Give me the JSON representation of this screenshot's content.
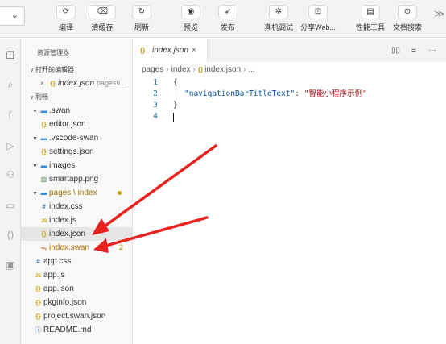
{
  "toolbar": {
    "project_dropdown_chevron": "⌄",
    "buttons": [
      {
        "name": "compile",
        "icon": "restart-icon",
        "glyph": "⟳",
        "label": "编译"
      },
      {
        "name": "clear-cache",
        "icon": "clear-cache-icon",
        "glyph": "⌫",
        "label": "清缓存"
      },
      {
        "name": "refresh",
        "icon": "refresh-icon",
        "glyph": "↻",
        "label": "刷新"
      },
      {
        "name": "preview",
        "icon": "eye-icon",
        "glyph": "◉",
        "label": "预览"
      },
      {
        "name": "publish",
        "icon": "send-icon",
        "glyph": "➶",
        "label": "发布"
      },
      {
        "name": "device-debug",
        "icon": "bug-icon",
        "glyph": "✲",
        "label": "真机调试"
      },
      {
        "name": "share-web",
        "icon": "share-icon",
        "glyph": "⊡",
        "label": "分享Web..."
      },
      {
        "name": "performance",
        "icon": "performance-icon",
        "glyph": "▤",
        "label": "性能工具"
      },
      {
        "name": "doc-search",
        "icon": "doc-search-icon",
        "glyph": "⊙",
        "label": "文档搜索"
      }
    ],
    "more": "≫"
  },
  "activity_bar": [
    {
      "name": "explorer",
      "icon": "files-icon",
      "glyph": "❐",
      "active": true
    },
    {
      "name": "search",
      "icon": "search-icon",
      "glyph": "⌕"
    },
    {
      "name": "source-control",
      "icon": "git-branch-icon",
      "glyph": "ᚴ"
    },
    {
      "name": "debug",
      "icon": "run-debug-icon",
      "glyph": "▷"
    },
    {
      "name": "extensions",
      "icon": "extensions-icon",
      "glyph": "⚇"
    },
    {
      "name": "simulator",
      "icon": "monitor-icon",
      "glyph": "▭"
    },
    {
      "name": "remote",
      "icon": "code-brackets-icon",
      "glyph": "⟨⟩"
    },
    {
      "name": "storage",
      "icon": "briefcase-icon",
      "glyph": "▣"
    }
  ],
  "sidebar": {
    "title": "资源管理器",
    "open_editors_header": "打开的编辑器",
    "open_editor": {
      "name": "index.json",
      "desc": "pages\\i..."
    },
    "project_header": "利畅",
    "tree": [
      {
        "type": "folder",
        "label": ".swan",
        "depth": 1
      },
      {
        "type": "json",
        "label": "editor.json",
        "depth": 2
      },
      {
        "type": "folder",
        "label": ".vscode-swan",
        "depth": 1
      },
      {
        "type": "json",
        "label": "settings.json",
        "depth": 2
      },
      {
        "type": "folder",
        "label": "images",
        "depth": 1
      },
      {
        "type": "png",
        "label": "smartapp.png",
        "depth": 2
      },
      {
        "type": "folder",
        "label": "pages \\ index",
        "depth": 1,
        "modified_dot": true
      },
      {
        "type": "css",
        "label": "index.css",
        "depth": 2
      },
      {
        "type": "js",
        "label": "index.js",
        "depth": 2
      },
      {
        "type": "json",
        "label": "index.json",
        "depth": 2,
        "selected": true
      },
      {
        "type": "swan",
        "label": "index.swan",
        "depth": 2,
        "badge": "2"
      },
      {
        "type": "css",
        "label": "app.css",
        "depth": 1
      },
      {
        "type": "js",
        "label": "app.js",
        "depth": 1
      },
      {
        "type": "json",
        "label": "app.json",
        "depth": 1
      },
      {
        "type": "json",
        "label": "pkginfo.json",
        "depth": 1
      },
      {
        "type": "json",
        "label": "project.swan.json",
        "depth": 1
      },
      {
        "type": "md",
        "label": "README.md",
        "depth": 1
      }
    ]
  },
  "editor": {
    "tab": {
      "icon_text": "{}",
      "name": "index.json",
      "close": "×"
    },
    "tab_actions": {
      "split": "▯▯",
      "layout": "≡",
      "more": "···"
    },
    "breadcrumbs": [
      "pages",
      "index",
      "index.json",
      "..."
    ],
    "code_lines": [
      {
        "n": "1",
        "text": "{"
      },
      {
        "n": "2",
        "key": "\"navigationBarTitleText\"",
        "sep": ": ",
        "value": "\"智能小程序示例\""
      },
      {
        "n": "3",
        "text": "}"
      },
      {
        "n": "4",
        "text": ""
      }
    ]
  },
  "colors": {
    "arrow": "#e8231f",
    "folder": "#3a8ad6",
    "json_icon": "#c9a400",
    "line_number": "#237893",
    "json_key": "#0451a5",
    "json_string": "#a31515"
  }
}
